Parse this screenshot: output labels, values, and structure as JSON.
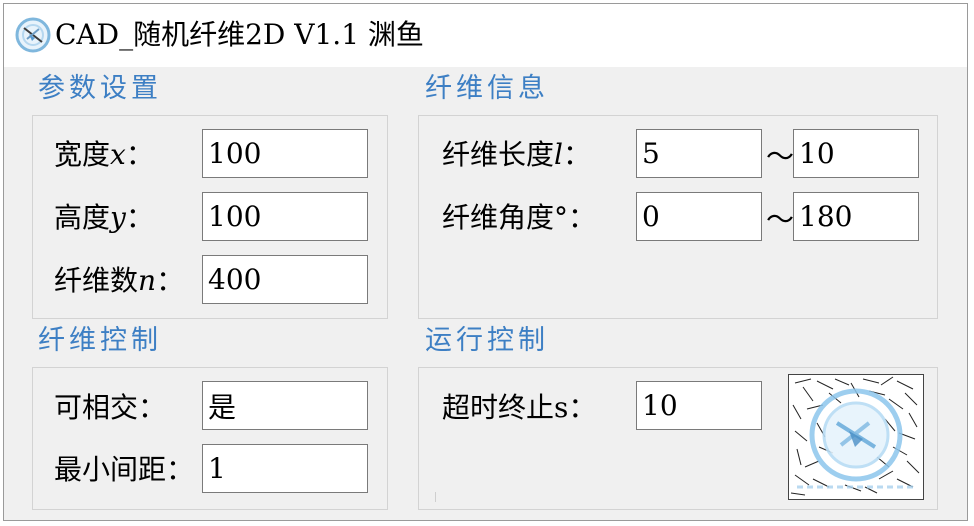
{
  "window": {
    "title": "CAD_随机纤维2D V1.1 渊鱼"
  },
  "params": {
    "section_title": "参数设置",
    "width_label": "宽度",
    "width_var": "x",
    "width_colon": "：",
    "width_value": "100",
    "height_label": "高度",
    "height_var": "y",
    "height_colon": "：",
    "height_value": "100",
    "count_label": "纤维数",
    "count_var": "n",
    "count_colon": "：",
    "count_value": "400"
  },
  "fiber_info": {
    "section_title": "纤维信息",
    "length_label": "纤维长度",
    "length_var": "l",
    "length_colon": "：",
    "length_min": "5",
    "length_max": "10",
    "angle_label": "纤维角度°：",
    "angle_min": "0",
    "angle_max": "180",
    "range_separator": "～"
  },
  "fiber_control": {
    "section_title": "纤维控制",
    "intersect_label": "可相交：",
    "intersect_value": "是",
    "min_gap_label": "最小间距：",
    "min_gap_value": "1"
  },
  "run_control": {
    "section_title": "运行控制",
    "timeout_label": "超时终止s：",
    "timeout_value": "10"
  },
  "icons": {
    "app_icon": "app-logo-icon",
    "logo": "fiber-logo-image"
  },
  "colors": {
    "section_title": "#3d7fc4",
    "window_bg": "#f0f0f0",
    "titlebar_bg": "#ffffff"
  }
}
